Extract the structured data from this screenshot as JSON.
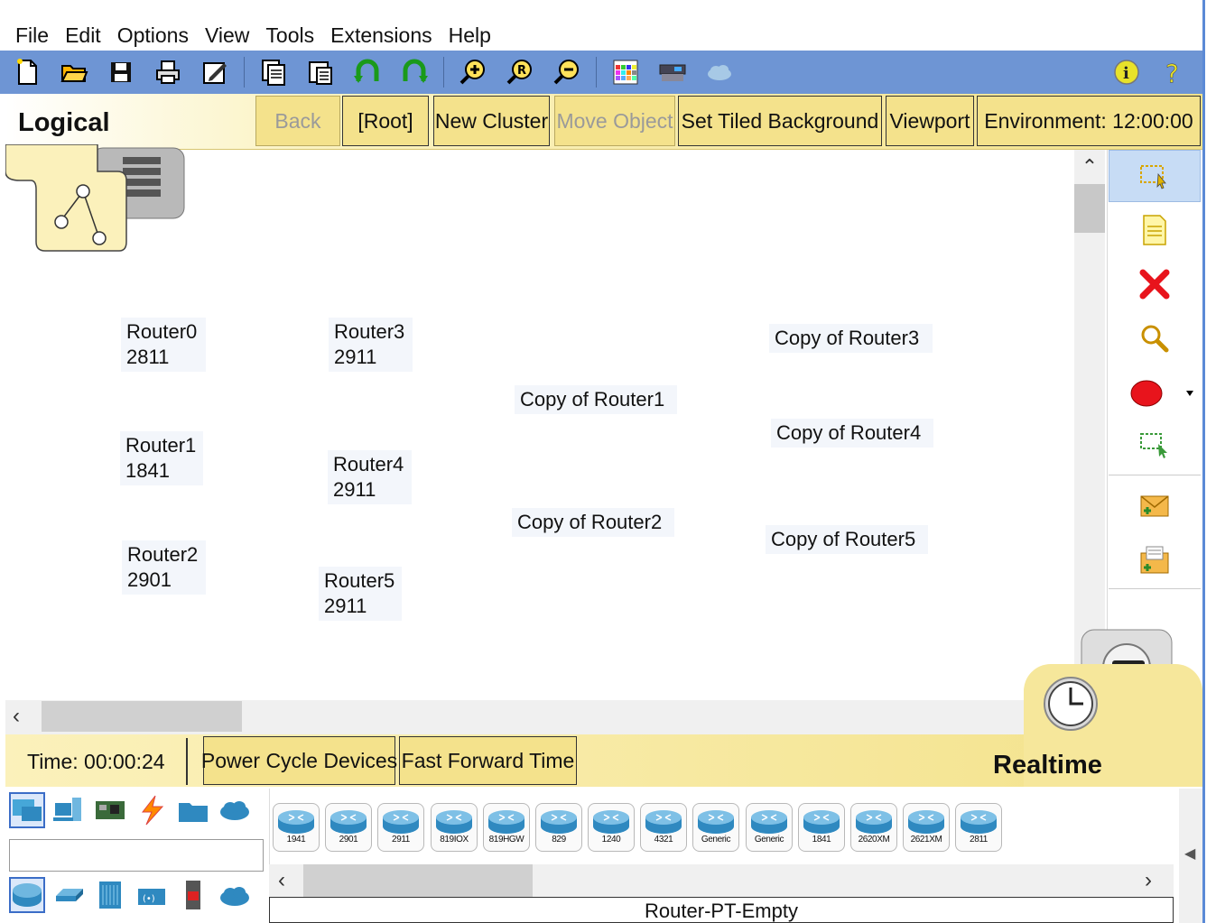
{
  "menu": [
    "File",
    "Edit",
    "Options",
    "View",
    "Tools",
    "Extensions",
    "Help"
  ],
  "toolbar_icons": [
    "new-file-icon",
    "open-folder-icon",
    "save-icon",
    "print-icon",
    "activity-wizard-icon",
    "copy-icon",
    "paste-icon",
    "undo-icon",
    "redo-icon",
    "zoom-in-icon",
    "zoom-reset-icon",
    "zoom-out-icon",
    "palette-icon",
    "custom-device-icon",
    "cloud-icon",
    "info-icon",
    "help-icon"
  ],
  "logical": {
    "title": "Logical",
    "back": "Back",
    "root": "[Root]",
    "new_cluster": "New Cluster",
    "move_object": "Move Object",
    "set_tiled_background": "Set Tiled Background",
    "viewport": "Viewport",
    "environment": "Environment: 12:00:00"
  },
  "devices": [
    {
      "name": "Router0",
      "model": "2811"
    },
    {
      "name": "Router1",
      "model": "1841"
    },
    {
      "name": "Router2",
      "model": "2901"
    },
    {
      "name": "Router3",
      "model": "2911"
    },
    {
      "name": "Router4",
      "model": "2911"
    },
    {
      "name": "Router5",
      "model": "2911"
    },
    {
      "name": "Copy of Router1"
    },
    {
      "name": "Copy of Router2"
    },
    {
      "name": "Copy of Router3"
    },
    {
      "name": "Copy of Router4"
    },
    {
      "name": "Copy of Router5"
    }
  ],
  "timebar": {
    "time": "Time: 00:00:24",
    "power_cycle": "Power Cycle Devices",
    "fast_forward": "Fast Forward Time",
    "mode": "Realtime"
  },
  "device_models": [
    "1941",
    "2901",
    "2911",
    "819IOX",
    "819HGW",
    "829",
    "1240",
    "4321",
    "Generic",
    "Generic",
    "1841",
    "2620XM",
    "2621XM",
    "2811"
  ],
  "selected_device": "Router-PT-Empty",
  "colors": {
    "toolbar": "#6e95d4",
    "header_yellow": "#f3e28a",
    "delete_red": "#e8141c"
  }
}
